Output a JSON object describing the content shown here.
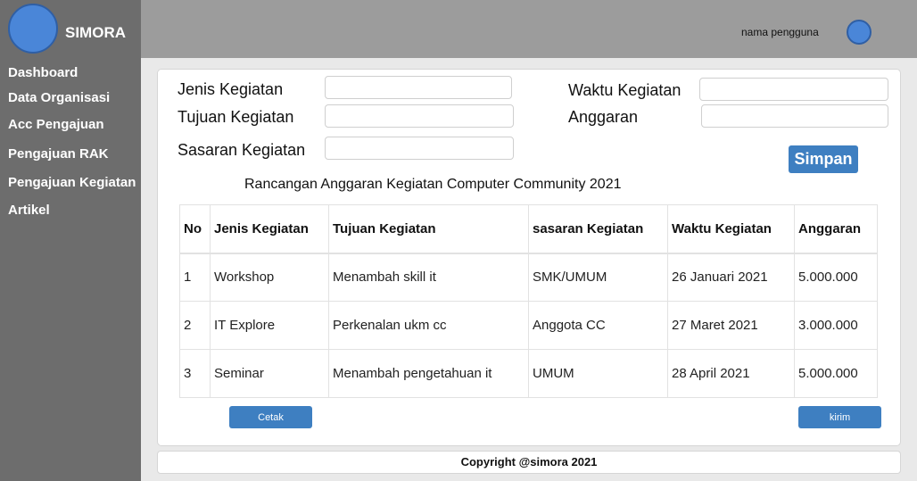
{
  "app": {
    "name": "SIMORA"
  },
  "sidebar": {
    "items": [
      {
        "label": "Dashboard"
      },
      {
        "label": "Data Organisasi"
      },
      {
        "label": "Acc Pengajuan"
      },
      {
        "label": "Pengajuan RAK"
      },
      {
        "label": "Pengajuan Kegiatan"
      },
      {
        "label": "Artikel"
      }
    ]
  },
  "header": {
    "user_name": "nama pengguna"
  },
  "form": {
    "jenis_label": "Jenis Kegiatan",
    "tujuan_label": "Tujuan Kegiatan",
    "sasaran_label": "Sasaran Kegiatan",
    "waktu_label": "Waktu Kegiatan",
    "anggaran_label": "Anggaran",
    "jenis_value": "",
    "tujuan_value": "",
    "sasaran_value": "",
    "waktu_value": "",
    "anggaran_value": "",
    "save_label": "Simpan"
  },
  "table": {
    "title": "Rancangan Anggaran Kegiatan Computer Community 2021",
    "headers": [
      "No",
      "Jenis Kegiatan",
      "Tujuan Kegiatan",
      "sasaran Kegiatan",
      "Waktu Kegiatan",
      "Anggaran"
    ],
    "rows": [
      [
        "1",
        "Workshop",
        "Menambah skill it",
        "SMK/UMUM",
        "26 Januari 2021",
        "5.000.000"
      ],
      [
        "2",
        "IT Explore",
        "Perkenalan ukm cc",
        "Anggota CC",
        "27 Maret 2021",
        "3.000.000"
      ],
      [
        "3",
        "Seminar",
        "Menambah pengetahuan it",
        "UMUM",
        "28 April 2021",
        "5.000.000"
      ]
    ]
  },
  "actions": {
    "print_label": "Cetak",
    "send_label": "kirim"
  },
  "footer": {
    "copyright": "Copyright @simora 2021"
  },
  "colors": {
    "sidebar_bg": "#6d6d6d",
    "topbar_bg": "#9c9c9c",
    "accent": "#3e7fc1",
    "avatar": "#4a86d8"
  },
  "icons": {
    "logo": "logo-circle-icon",
    "avatar": "user-avatar-icon"
  }
}
